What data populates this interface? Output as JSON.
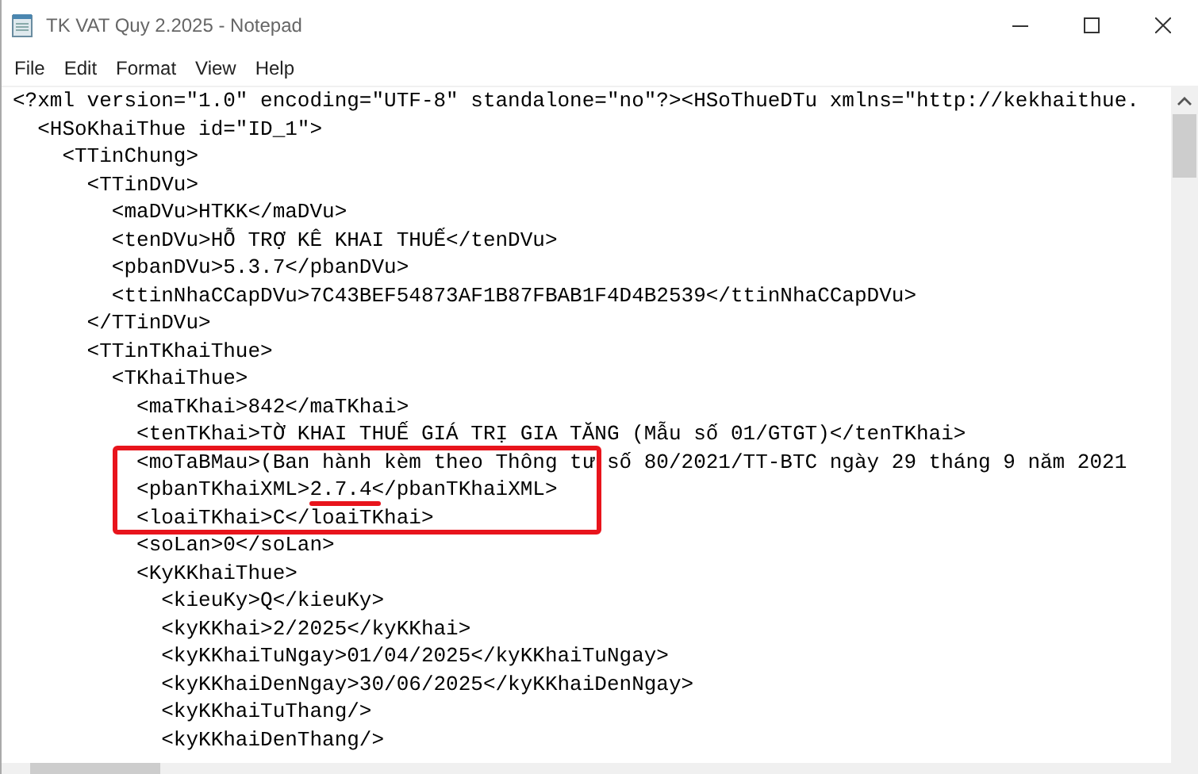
{
  "window": {
    "title": "TK VAT Quy 2.2025 - Notepad"
  },
  "menu": [
    "File",
    "Edit",
    "Format",
    "View",
    "Help"
  ],
  "editor": {
    "lines": [
      {
        "text": "<?xml version=\"1.0\" encoding=\"UTF-8\" standalone=\"no\"?><HSoThueDTu xmlns=\"http://kekhaithue.",
        "boxed": false
      },
      {
        "text": "  <HSoKhaiThue id=\"ID_1\">",
        "boxed": false
      },
      {
        "text": "    <TTinChung>",
        "boxed": false
      },
      {
        "text": "      <TTinDVu>",
        "boxed": false
      },
      {
        "text": "        <maDVu>HTKK</maDVu>",
        "boxed": false
      },
      {
        "text": "        <tenDVu>HỖ TRỢ KÊ KHAI THUẾ</tenDVu>",
        "boxed": false
      },
      {
        "text": "        <pbanDVu>5.3.7</pbanDVu>",
        "boxed": false
      },
      {
        "text": "        <ttinNhaCCapDVu>7C43BEF54873AF1B87FBAB1F4D4B2539</ttinNhaCCapDVu>",
        "boxed": false
      },
      {
        "text": "      </TTinDVu>",
        "boxed": false
      },
      {
        "text": "      <TTinTKhaiThue>",
        "boxed": false
      },
      {
        "text": "        <TKhaiThue>",
        "boxed": false
      },
      {
        "text": "          <maTKhai>842</maTKhai>",
        "boxed": false
      },
      {
        "text": "          <tenTKhai>TỜ KHAI THUẾ GIÁ TRỊ GIA TĂNG (Mẫu số 01/GTGT)</tenTKhai>",
        "boxed": false
      },
      {
        "text": "          <moTaBMau>(Ban hành kèm theo Thông tư số 80/2021/TT-BTC ngày 29 tháng 9 năm 2021",
        "boxed": true
      },
      {
        "parts": [
          {
            "text": "          <pbanTKhaiXML>",
            "underlined": false
          },
          {
            "text": "2.7.4",
            "underlined": true
          },
          {
            "text": "</pbanTKhaiXML>",
            "underlined": false
          }
        ],
        "boxed": true
      },
      {
        "text": "          <loaiTKhai>C</loaiTKhai>",
        "boxed": true
      },
      {
        "text": "          <soLan>0</soLan>",
        "boxed": false
      },
      {
        "text": "          <KyKKhaiThue>",
        "boxed": false
      },
      {
        "text": "            <kieuKy>Q</kieuKy>",
        "boxed": false
      },
      {
        "text": "            <kyKKhai>2/2025</kyKKhai>",
        "boxed": false
      },
      {
        "text": "            <kyKKhaiTuNgay>01/04/2025</kyKKhaiTuNgay>",
        "boxed": false
      },
      {
        "text": "            <kyKKhaiDenNgay>30/06/2025</kyKKhaiDenNgay>",
        "boxed": false
      },
      {
        "text": "            <kyKKhaiTuThang/>",
        "boxed": false
      },
      {
        "text": "            <kyKKhaiDenThang/>",
        "boxed": false
      }
    ]
  }
}
